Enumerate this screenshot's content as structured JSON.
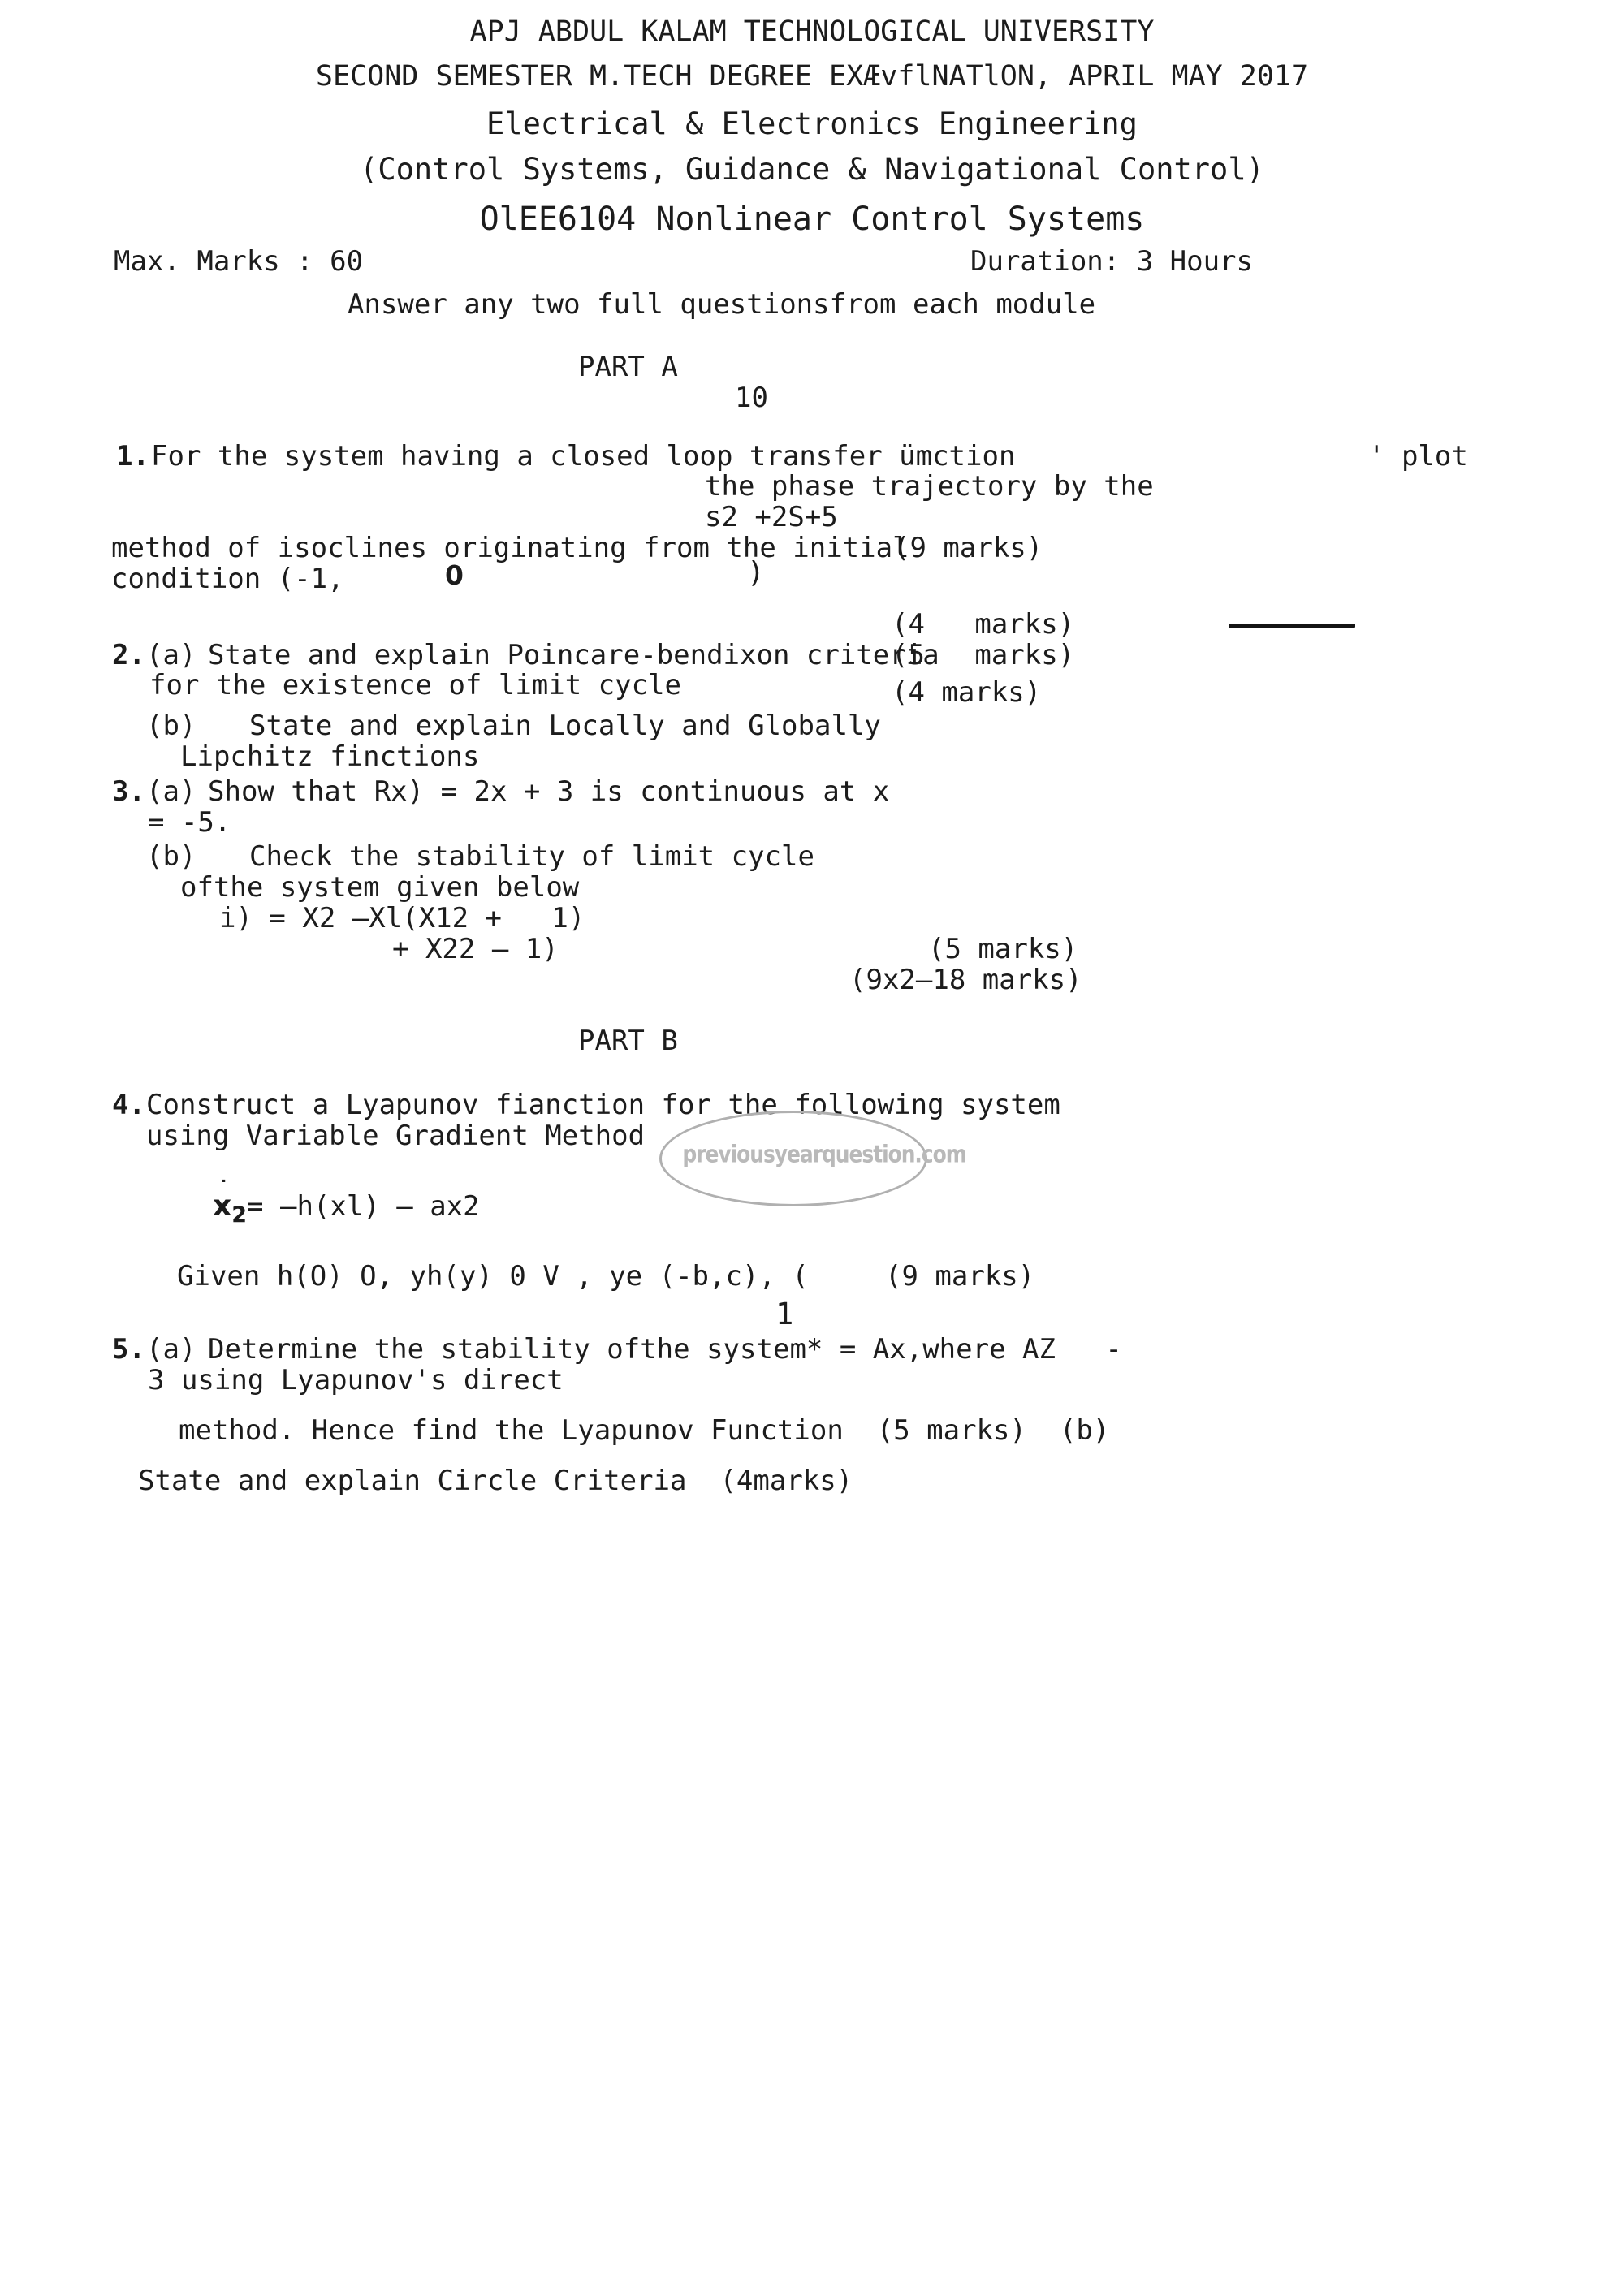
{
  "document": {
    "kind": "examination-question-paper",
    "page_number": "1"
  },
  "header": {
    "university": "APJ ABDUL KALAM TECHNOLOGICAL UNIVERSITY",
    "exam_line": "SECOND SEMESTER M.TECH DEGREE EXÆvflNATlON, APRIL MAY 2017",
    "branch": "Electrical & Electronics Engineering",
    "specialization": "(Control Systems, Guidance & Navigational Control)",
    "course": "OlEE6104 Nonlinear Control Systems",
    "max_marks": "Max. Marks : 60",
    "duration": "Duration: 3 Hours",
    "instruction": "Answer any two full questionsfrom each module"
  },
  "parts": {
    "part_a_label": "PART A",
    "part_a_marks": "10",
    "part_b_label": "PART B"
  },
  "questions": {
    "q1": {
      "number": "1.",
      "line1": "For the system having a closed loop transfer ümction",
      "line1_tail": "' plot",
      "line2": "the phase trajectory by the",
      "line3": "s2 +2S+5",
      "line4": "method of isoclines originating from the initial",
      "line5": "condition (-1,",
      "line5_zero": "0",
      "line5_close": ")",
      "marks": "(9 marks)"
    },
    "q2": {
      "number": "2.",
      "a_label": "(a)",
      "a_line1": "State and explain Poincare-bendixon criteria",
      "a_line2": "for the existence of limit cycle",
      "b_label": "(b)",
      "b_line1": "State and explain Locally and Globally",
      "b_line2": "Lipchitz finctions",
      "marks_top": "(4   marks)",
      "marks_mid": "(5   marks)",
      "marks_low": "(4 marks)"
    },
    "q3": {
      "number": "3.",
      "a_label": "(a)",
      "a_line1": "Show that Rx) = 2x + 3 is continuous at x",
      "a_line2": "= -5.",
      "b_label": "(b)",
      "b_line1": "Check the stability of limit cycle",
      "b_line2": "ofthe system given below",
      "b_eq1": "i) = X2 —Xl(X12 +   1)",
      "b_eq2": "+ X22 — 1)",
      "marks": "(5 marks)",
      "total_marks": "(9x2—18 marks)"
    },
    "q4": {
      "number": "4.",
      "line1": "Construct a Lyapunov fianction for the following system",
      "line2": "using Variable Gradient Method",
      "eq_lhs_x": "x",
      "eq_lhs_sub": "2",
      "eq_rhs": "= —h(xl) — ax2",
      "given": "Given h(O) O, yh(y) 0 V , ye (-b,c), (",
      "marks": "(9 marks)"
    },
    "q5": {
      "number": "5.",
      "a_label": "(a)",
      "a_line1": "Determine the stability ofthe system* = Ax,where AZ   -",
      "a_line2": "3 using Lyapunov's direct",
      "a_line3": "method. Hence find the Lyapunov Function  (5 marks)  (b)",
      "b_line1": "State and explain Circle Criteria  (4marks)"
    }
  },
  "watermark": {
    "text": "previousyearquestion.com",
    "color": "#b9b9b9"
  }
}
